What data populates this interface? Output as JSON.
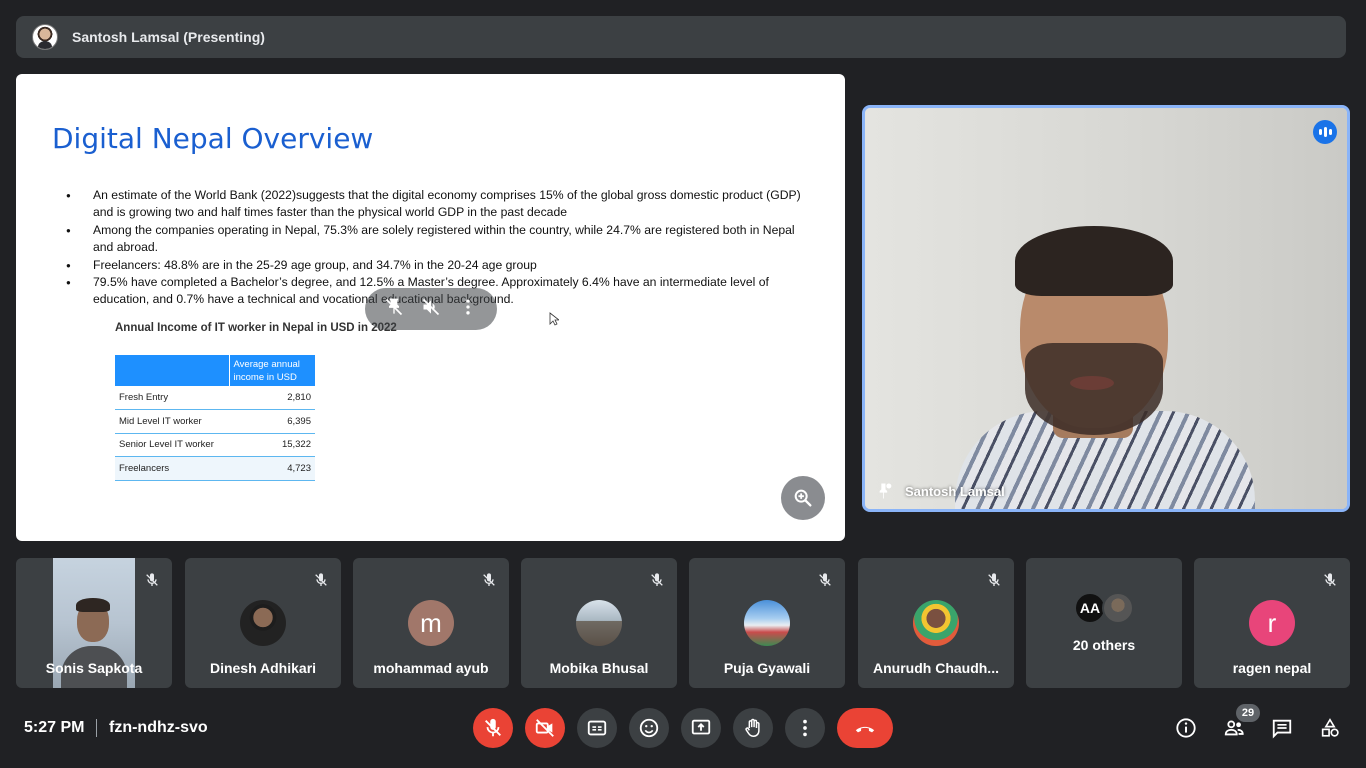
{
  "presentation_bar": {
    "title": "Santosh Lamsal (Presenting)"
  },
  "slide": {
    "title": "Digital Nepal Overview",
    "bullets": [
      "An estimate of the World Bank (2022)suggests that the digital economy comprises 15% of the global gross domestic product (GDP) and is growing two and half times faster than the physical world GDP in the past decade",
      "Among the companies operating in Nepal, 75.3% are solely registered within the country, while 24.7% are registered both in Nepal and abroad.",
      "Freelancers: 48.8% are in the 25-29 age group, and 34.7% in the 20-24 age group",
      "79.5% have completed a Bachelor’s degree, and 12.5% a Master’s degree. Approximately 6.4% have an intermediate level of education, and 0.7% have a technical and vocational educational background."
    ],
    "table": {
      "title": "Annual Income of IT worker in Nepal in USD in 2022",
      "header": "Average annual income in USD",
      "rows": [
        {
          "label": "Fresh Entry",
          "value": "2,810"
        },
        {
          "label": "Mid Level IT worker",
          "value": "6,395"
        },
        {
          "label": "Senior Level IT worker",
          "value": "15,322"
        },
        {
          "label": "Freelancers",
          "value": "4,723"
        }
      ]
    }
  },
  "speaker": {
    "name": "Santosh Lamsal"
  },
  "participants": [
    {
      "name": "Sonis Sapkota",
      "type": "video"
    },
    {
      "name": "Dinesh Adhikari",
      "type": "photo"
    },
    {
      "name": "mohammad ayub",
      "type": "letter",
      "letter": "m",
      "color": "#a1776a"
    },
    {
      "name": "Mobika Bhusal",
      "type": "photo"
    },
    {
      "name": "Puja Gyawali",
      "type": "photo"
    },
    {
      "name": "Anurudh Chaudh...",
      "type": "photo"
    },
    {
      "name": "20 others",
      "type": "others",
      "avatar_text": "AA"
    },
    {
      "name": "ragen nepal",
      "type": "letter",
      "letter": "r",
      "color": "#e8457a"
    }
  ],
  "bottom_bar": {
    "time": "5:27 PM",
    "meeting_code": "fzn-ndhz-svo",
    "participant_count": "29"
  },
  "colors": {
    "background": "#202124",
    "tile": "#3c4043",
    "accent_blue": "#8ab4f8",
    "danger_red": "#ea4335",
    "slide_title_blue": "#1a5fd0",
    "table_header_blue": "#1e90ff"
  },
  "icons": {
    "controls": [
      "mic-off-icon",
      "camera-off-icon",
      "captions-icon",
      "emoji-icon",
      "present-icon",
      "raise-hand-icon",
      "more-options-icon",
      "hang-up-icon"
    ],
    "right": [
      "info-icon",
      "people-icon",
      "chat-icon",
      "activities-icon"
    ]
  }
}
